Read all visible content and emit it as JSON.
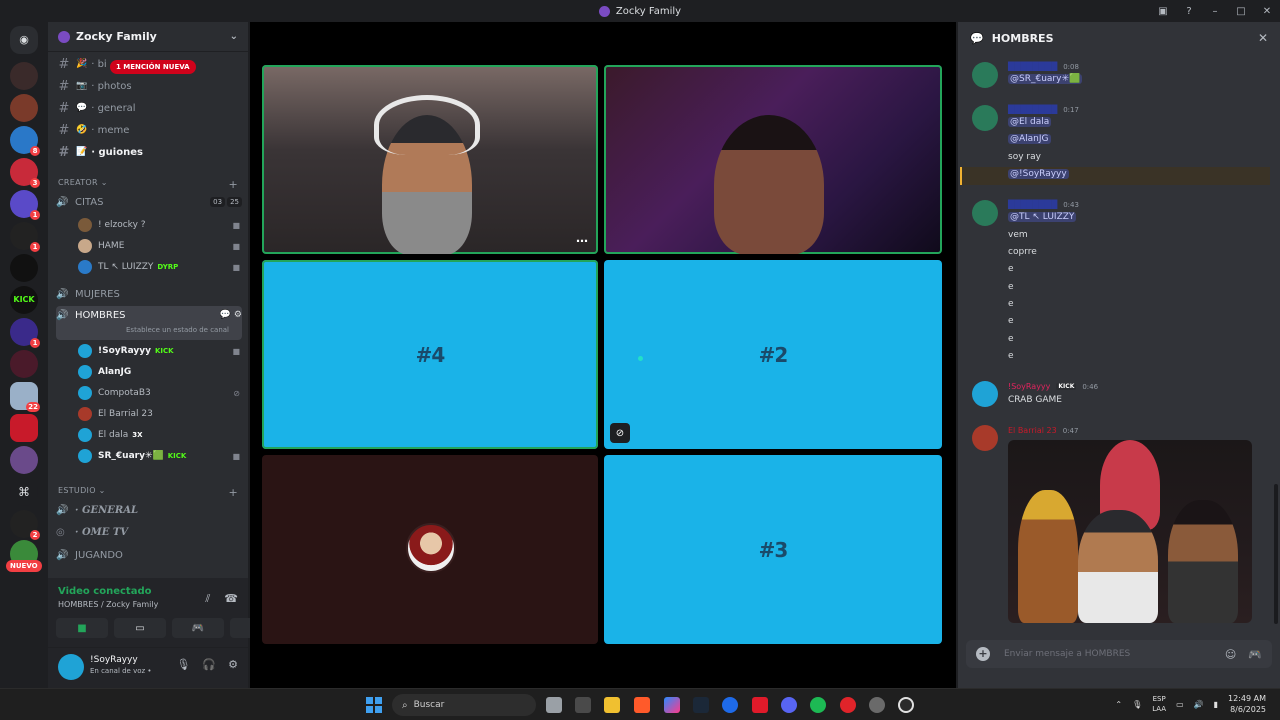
{
  "window": {
    "title": "Zocky Family"
  },
  "guild_badges": {
    "b1": "8",
    "b2": "3",
    "b3": "1",
    "b4": "1",
    "b5": "1",
    "b6": "22",
    "b7": "2"
  },
  "guild_nuevo": "NUEVO",
  "server": {
    "name": "Zocky Family"
  },
  "mention_pill": "1 MENCIÓN NUEVA",
  "text_channels": [
    {
      "name": "· bi",
      "emoji": "🎉"
    },
    {
      "name": "· photos",
      "emoji": "📷"
    },
    {
      "name": "· general",
      "emoji": "💬"
    },
    {
      "name": "· meme",
      "emoji": "🤣"
    },
    {
      "name": "· guiones",
      "emoji": "📝"
    }
  ],
  "categories": {
    "creator": "CREATOR",
    "estudio": "ESTUDIO"
  },
  "voice_channels": {
    "citas": {
      "name": "CITAS",
      "count_a": "03",
      "count_b": "25"
    },
    "mujeres": {
      "name": "MUJERES"
    },
    "hombres": {
      "name": "HOMBRES",
      "status_placeholder": "Establece un estado de canal"
    },
    "general": {
      "name": "· GENERAL"
    },
    "ometv": {
      "name": "· OME TV"
    },
    "jugando": {
      "name": "JUGANDO"
    }
  },
  "citas_members": [
    {
      "name": "! elzocky ?"
    },
    {
      "name": "HAME"
    },
    {
      "name": "TL ↖ LUIZZY",
      "tag": "DYRP"
    }
  ],
  "hombres_members": [
    {
      "name": "!SoyRayyy",
      "tag": "KICK"
    },
    {
      "name": "AlanJG"
    },
    {
      "name": "CompotaB3"
    },
    {
      "name": "El Barrial 23"
    },
    {
      "name": "El dala",
      "tag": "3X"
    },
    {
      "name": "SR_€uary✳🟩",
      "tag": "KICK"
    }
  ],
  "voice_panel": {
    "status": "Video conectado",
    "where": "HOMBRES / Zocky Family"
  },
  "user_panel": {
    "name": "!SoyRayyy",
    "sub": "En canal de voz •"
  },
  "stage": {
    "tiles": [
      {
        "label": ""
      },
      {
        "label": ""
      },
      {
        "label": "#4"
      },
      {
        "label": "#2"
      },
      {
        "label": ""
      },
      {
        "label": "#3"
      }
    ]
  },
  "chat": {
    "title": "HOMBRES",
    "messages": [
      {
        "time": "0:08",
        "lines": [
          "@SR_€uary✳🟩"
        ]
      },
      {
        "time": "0:17",
        "lines": [
          "@El dala",
          "@AlanJG",
          "soy ray",
          "@!SoyRayyy"
        ]
      },
      {
        "time": "0:43",
        "lines": [
          "@TL ↖ LUIZZY",
          "vem",
          "coprre",
          "e",
          "e",
          "e",
          "e",
          "e",
          "e"
        ]
      },
      {
        "author": "!SoyRayyy",
        "tag": "KICK",
        "time": "0:46",
        "lines": [
          "CRAB GAME"
        ]
      },
      {
        "author": "El Barrial 23",
        "time": "0:47",
        "lines": []
      }
    ],
    "input_placeholder": "Enviar mensaje a HOMBRES"
  },
  "taskbar": {
    "search": "Buscar",
    "lang_top": "ESP",
    "lang_bottom": "LAA",
    "time": "12:49 AM",
    "date": "8/6/2025"
  },
  "colors": {
    "accent": "#23a55a",
    "tile_blue": "#1ab3e8",
    "mention": "#d0021b"
  }
}
